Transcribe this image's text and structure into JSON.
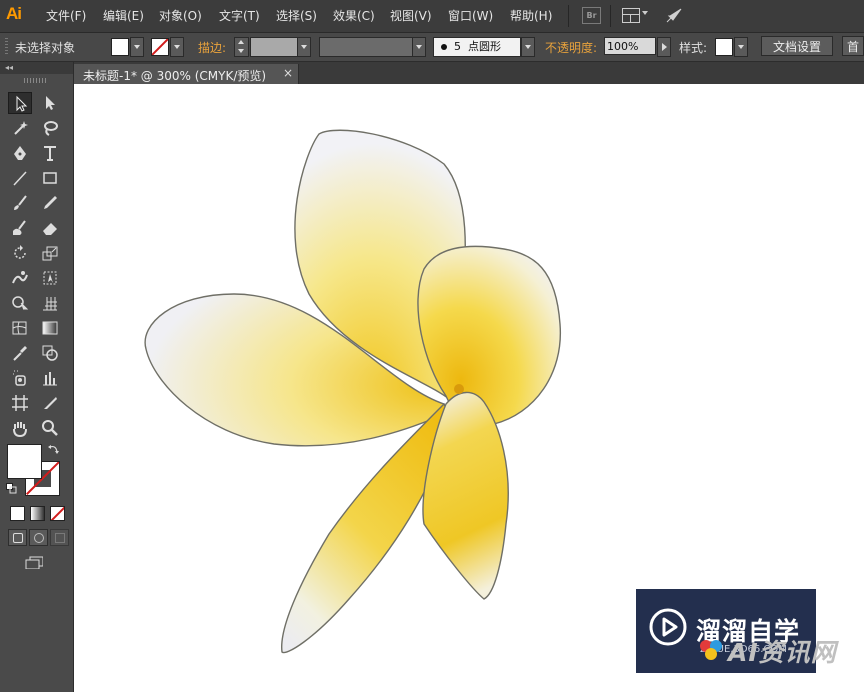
{
  "app": {
    "logo": "Ai"
  },
  "menu": [
    {
      "label": "文件(F)"
    },
    {
      "label": "编辑(E)"
    },
    {
      "label": "对象(O)"
    },
    {
      "label": "文字(T)"
    },
    {
      "label": "选择(S)"
    },
    {
      "label": "效果(C)"
    },
    {
      "label": "视图(V)"
    },
    {
      "label": "窗口(W)"
    },
    {
      "label": "帮助(H)"
    }
  ],
  "menubar_icons": {
    "bridge": "Br",
    "arrange": "arrange-documents-icon",
    "sync": "sync-rocket-icon"
  },
  "control_bar": {
    "selection_status": "未选择对象",
    "stroke_label": "描边:",
    "brush_size": "5",
    "brush_shape": "点圆形",
    "opacity_label": "不透明度:",
    "opacity_value": "100%",
    "style_label": "样式:",
    "doc_setup_button": "文档设置",
    "prefs_button": "首"
  },
  "document": {
    "tab_title": "未标题-1* @ 300% (CMYK/预览)",
    "close_glyph": "×"
  },
  "tools": [
    {
      "name": "selection-tool",
      "selected": true
    },
    {
      "name": "direct-selection-tool"
    },
    {
      "name": "magic-wand-tool"
    },
    {
      "name": "lasso-tool"
    },
    {
      "name": "pen-tool"
    },
    {
      "name": "type-tool"
    },
    {
      "name": "line-segment-tool"
    },
    {
      "name": "rectangle-tool"
    },
    {
      "name": "paintbrush-tool"
    },
    {
      "name": "pencil-tool"
    },
    {
      "name": "blob-brush-tool"
    },
    {
      "name": "eraser-tool"
    },
    {
      "name": "rotate-tool"
    },
    {
      "name": "scale-tool"
    },
    {
      "name": "warp-tool"
    },
    {
      "name": "free-transform-tool"
    },
    {
      "name": "shape-builder-tool"
    },
    {
      "name": "perspective-grid-tool"
    },
    {
      "name": "mesh-tool"
    },
    {
      "name": "gradient-tool"
    },
    {
      "name": "eyedropper-tool"
    },
    {
      "name": "blend-tool"
    },
    {
      "name": "symbol-sprayer-tool"
    },
    {
      "name": "column-graph-tool"
    },
    {
      "name": "artboard-tool"
    },
    {
      "name": "slice-tool"
    },
    {
      "name": "hand-tool"
    },
    {
      "name": "zoom-tool"
    }
  ],
  "colors": {
    "fill": "#ffffff",
    "stroke": "none",
    "none_red": "#d21c1c",
    "ui_dark": "#3c3c3c",
    "ui_panel": "#4a4a4a",
    "accent_orange": "#e8a23c",
    "flower_yellow": "#f2cf1f"
  },
  "watermark": {
    "title": "溜溜自学",
    "url": "ZIXUE.3D66.COM",
    "overlay_text": "AI资讯网"
  }
}
